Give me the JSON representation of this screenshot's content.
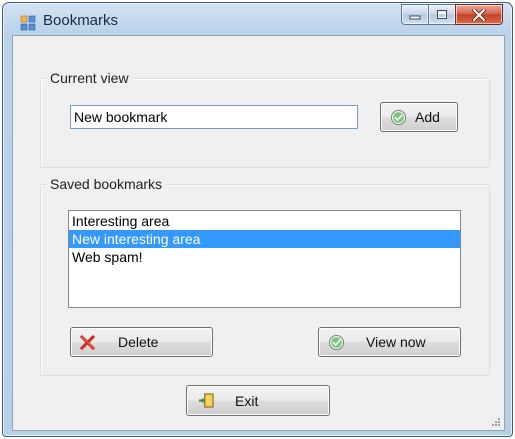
{
  "window": {
    "title": "Bookmarks",
    "caption": {
      "minimize_icon": "minimize-icon",
      "maximize_icon": "maximize-icon",
      "close_icon": "close-icon"
    }
  },
  "current_view": {
    "group_label": "Current view",
    "bookmark_name_value": "New bookmark",
    "add_button_label": "Add",
    "add_icon": "check-circle-icon"
  },
  "saved_bookmarks": {
    "group_label": "Saved bookmarks",
    "items": [
      {
        "label": "Interesting area",
        "selected": false
      },
      {
        "label": "New interesting area",
        "selected": true
      },
      {
        "label": "Web spam!",
        "selected": false
      }
    ],
    "delete_button_label": "Delete",
    "delete_icon": "red-x-icon",
    "view_now_button_label": "View now",
    "view_now_icon": "check-circle-icon"
  },
  "footer": {
    "exit_button_label": "Exit",
    "exit_icon": "exit-door-icon"
  },
  "colors": {
    "selection": "#3399ff",
    "close_button": "#c3422c",
    "title_bar": "#bcd3ea"
  }
}
